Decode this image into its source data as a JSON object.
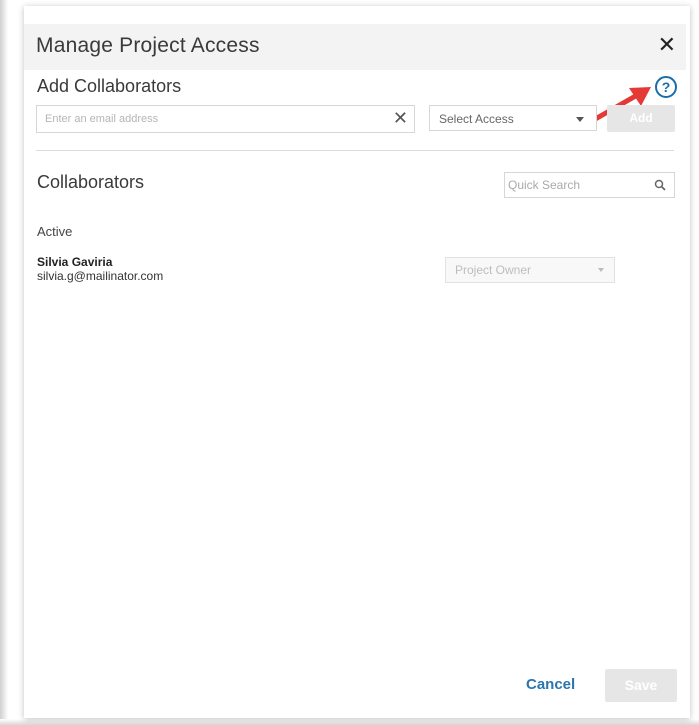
{
  "dialog": {
    "title": "Manage Project Access",
    "close_label": "✕"
  },
  "add_collaborators": {
    "title": "Add Collaborators",
    "help_label": "?",
    "email_placeholder": "Enter an email address",
    "email_value": "",
    "clear_label": "✕",
    "access_select_value": "Select Access",
    "add_button_label": "Add"
  },
  "collaborators": {
    "title": "Collaborators",
    "search_placeholder": "Quick Search",
    "group_label": "Active",
    "items": [
      {
        "name": "Silvia Gaviria",
        "email": "silvia.g@mailinator.com",
        "role": "Project Owner"
      }
    ]
  },
  "footer": {
    "cancel_label": "Cancel",
    "save_label": "Save"
  },
  "colors": {
    "accent": "#2a75ad",
    "help_icon": "#1a6ea8",
    "arrow": "#e53935",
    "disabled_button": "#e6e6e6"
  },
  "icons": [
    "close-icon",
    "help-icon",
    "clear-icon",
    "caret-down-icon",
    "search-icon",
    "annotation-arrow-icon"
  ]
}
